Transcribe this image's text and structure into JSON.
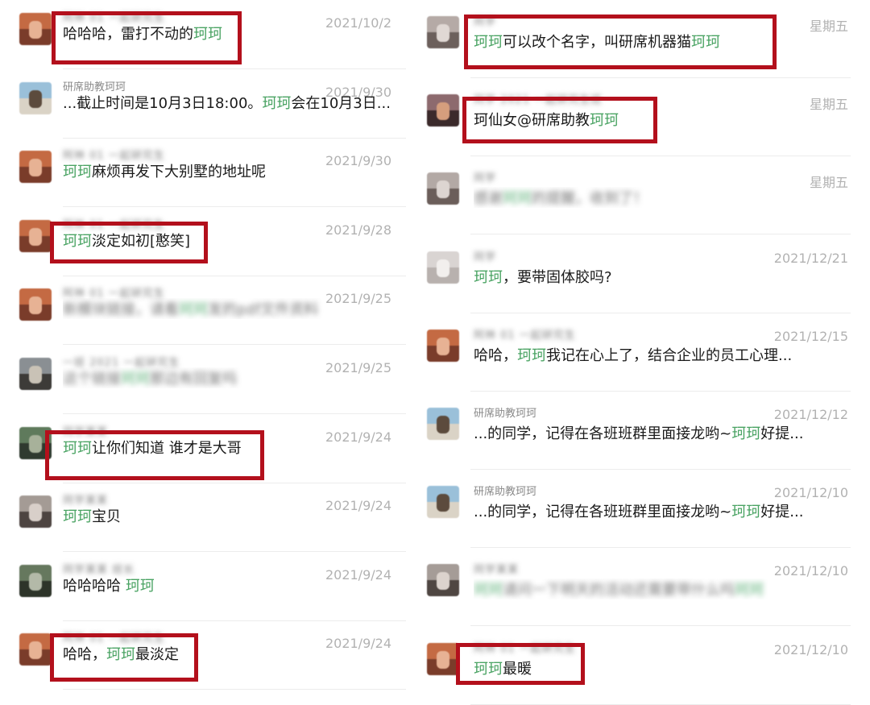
{
  "left_column": [
    {
      "name": "阿林 01 一起研究生",
      "date": "2021/10/2",
      "message": [
        {
          "t": "哈哈哈，雷打不动的"
        },
        {
          "t": "珂珂",
          "hl": true
        }
      ],
      "blurred_name": true,
      "blurred_msg": false,
      "avatar": {
        "top": "#c46a43",
        "bottom": "#7a3c2a",
        "mid": "#e7b294"
      }
    },
    {
      "name": "研席助教珂珂",
      "date": "2021/9/30",
      "message": [
        {
          "t": "...截止时间是10月3日18:00。"
        },
        {
          "t": "珂珂",
          "hl": true
        },
        {
          "t": "会在10月3日..."
        }
      ],
      "blurred_name": false,
      "blurred_msg": false,
      "avatar": {
        "top": "#9ac0d9",
        "bottom": "#dad3c6",
        "mid": "#5c4b3d"
      }
    },
    {
      "name": "阿林 01 一起研究生",
      "date": "2021/9/30",
      "message": [
        {
          "t": "珂珂",
          "hl": true
        },
        {
          "t": "麻烦再发下大别墅的地址呢"
        }
      ],
      "blurred_name": true,
      "blurred_msg": false,
      "avatar": {
        "top": "#c46a43",
        "bottom": "#7a3c2a",
        "mid": "#e7b294"
      }
    },
    {
      "name": "阿林 01 一起研究生",
      "date": "2021/9/28",
      "message": [
        {
          "t": "珂珂",
          "hl": true
        },
        {
          "t": "淡定如初[憨笑]"
        }
      ],
      "blurred_name": true,
      "blurred_msg": false,
      "avatar": {
        "top": "#c46a43",
        "bottom": "#7a3c2a",
        "mid": "#e7b294"
      }
    },
    {
      "name": "阿林 01 一起研究生",
      "date": "2021/9/25",
      "message": [
        {
          "t": "新模块链接，请看"
        },
        {
          "t": "珂珂",
          "hl": true
        },
        {
          "t": "发的pdf文件资料"
        }
      ],
      "blurred_name": true,
      "blurred_msg": true,
      "avatar": {
        "top": "#c46a43",
        "bottom": "#7a3c2a",
        "mid": "#e7b294"
      }
    },
    {
      "name": "一班 2021 一起研究生",
      "date": "2021/9/25",
      "message": [
        {
          "t": "这个链接"
        },
        {
          "t": "珂珂",
          "hl": true
        },
        {
          "t": "那边有回复吗"
        }
      ],
      "blurred_name": true,
      "blurred_msg": true,
      "avatar": {
        "top": "#8a8f93",
        "bottom": "#3d3b38",
        "mid": "#c9c2b6"
      }
    },
    {
      "name": "同学某某",
      "date": "2021/9/24",
      "message": [
        {
          "t": "珂珂",
          "hl": true
        },
        {
          "t": "让你们知道  谁才是大哥"
        }
      ],
      "blurred_name": true,
      "blurred_msg": false,
      "avatar": {
        "top": "#5f7a5c",
        "bottom": "#2f3a2f",
        "mid": "#a7b19a"
      }
    },
    {
      "name": "同学某某",
      "date": "2021/9/24",
      "message": [
        {
          "t": "珂珂",
          "hl": true
        },
        {
          "t": "宝贝"
        }
      ],
      "blurred_name": true,
      "blurred_msg": false,
      "avatar": {
        "top": "#a49b95",
        "bottom": "#4d4441",
        "mid": "#d8cfc9"
      }
    },
    {
      "name": "同学某某 班长",
      "date": "2021/9/24",
      "message": [
        {
          "t": "哈哈哈哈  "
        },
        {
          "t": "珂珂",
          "hl": true
        }
      ],
      "blurred_name": true,
      "blurred_msg": false,
      "avatar": {
        "top": "#66785e",
        "bottom": "#2d3429",
        "mid": "#b3b9a8"
      }
    },
    {
      "name": "阿林 01 一起研究生",
      "date": "2021/9/24",
      "message": [
        {
          "t": "哈哈，"
        },
        {
          "t": "珂珂",
          "hl": true
        },
        {
          "t": "最淡定"
        }
      ],
      "blurred_name": true,
      "blurred_msg": false,
      "avatar": {
        "top": "#c46a43",
        "bottom": "#7a3c2a",
        "mid": "#e7b294"
      }
    }
  ],
  "right_column": [
    {
      "name": "同学",
      "date": "星期五",
      "message": [
        {
          "t": "珂珂",
          "hl": true
        },
        {
          "t": "可以改个名字，叫研席机器猫"
        },
        {
          "t": "珂珂",
          "hl": true
        }
      ],
      "blurred_name": true,
      "blurred_msg": false,
      "avatar": {
        "top": "#b5aaa6",
        "bottom": "#6c605c",
        "mid": "#e0d8d4"
      }
    },
    {
      "name": "同学 2021 一起研究生班",
      "date": "星期五",
      "message": [
        {
          "t": "珂仙女@研席助教"
        },
        {
          "t": "珂珂",
          "hl": true
        }
      ],
      "blurred_name": true,
      "blurred_msg": false,
      "avatar": {
        "top": "#8d6a6e",
        "bottom": "#3b2a2b",
        "mid": "#d59e7d"
      }
    },
    {
      "name": "同学",
      "date": "星期五",
      "message": [
        {
          "t": "感谢"
        },
        {
          "t": "珂珂",
          "hl": true
        },
        {
          "t": "的提醒，收到了！"
        }
      ],
      "blurred_name": true,
      "blurred_msg": true,
      "avatar": {
        "top": "#b3a9a5",
        "bottom": "#6b5e5a",
        "mid": "#ddd5d1"
      }
    },
    {
      "name": "同学",
      "date": "2021/12/21",
      "message": [
        {
          "t": "珂珂",
          "hl": true
        },
        {
          "t": "，要带固体胶吗?"
        }
      ],
      "blurred_name": true,
      "blurred_msg": false,
      "avatar": {
        "top": "#d9d4d2",
        "bottom": "#b8b1ae",
        "mid": "#f2efed"
      }
    },
    {
      "name": "阿林 01 一起研究生",
      "date": "2021/12/15",
      "message": [
        {
          "t": "哈哈，"
        },
        {
          "t": "珂珂",
          "hl": true
        },
        {
          "t": "我记在心上了，结合企业的员工心理..."
        }
      ],
      "blurred_name": true,
      "blurred_msg": false,
      "avatar": {
        "top": "#c46a43",
        "bottom": "#7a3c2a",
        "mid": "#e7b294"
      }
    },
    {
      "name": "研席助教珂珂",
      "date": "2021/12/12",
      "message": [
        {
          "t": "...的同学，记得在各班班群里面接龙哟~"
        },
        {
          "t": "珂珂",
          "hl": true
        },
        {
          "t": "好提..."
        }
      ],
      "blurred_name": false,
      "blurred_msg": false,
      "avatar": {
        "top": "#9ac0d9",
        "bottom": "#dad3c6",
        "mid": "#5c4b3d"
      }
    },
    {
      "name": "研席助教珂珂",
      "date": "2021/12/10",
      "message": [
        {
          "t": "...的同学，记得在各班班群里面接龙哟~"
        },
        {
          "t": "珂珂",
          "hl": true
        },
        {
          "t": "好提..."
        }
      ],
      "blurred_name": false,
      "blurred_msg": false,
      "avatar": {
        "top": "#9ac0d9",
        "bottom": "#dad3c6",
        "mid": "#5c4b3d"
      }
    },
    {
      "name": "同学某某",
      "date": "2021/12/10",
      "message": [
        {
          "t": "珂珂",
          "hl": true
        },
        {
          "t": "请问一下明天的活动还需要带什么吗"
        },
        {
          "t": "珂珂",
          "hl": true
        }
      ],
      "blurred_name": true,
      "blurred_msg": true,
      "avatar": {
        "top": "#a59c97",
        "bottom": "#4f4642",
        "mid": "#dcd3cd"
      }
    },
    {
      "name": "阿林 01 一起研究生",
      "date": "2021/12/10",
      "message": [
        {
          "t": "珂珂",
          "hl": true
        },
        {
          "t": "最暖"
        }
      ],
      "blurred_name": true,
      "blurred_msg": false,
      "avatar": {
        "top": "#c46a43",
        "bottom": "#7a3c2a",
        "mid": "#e7b294"
      }
    }
  ]
}
